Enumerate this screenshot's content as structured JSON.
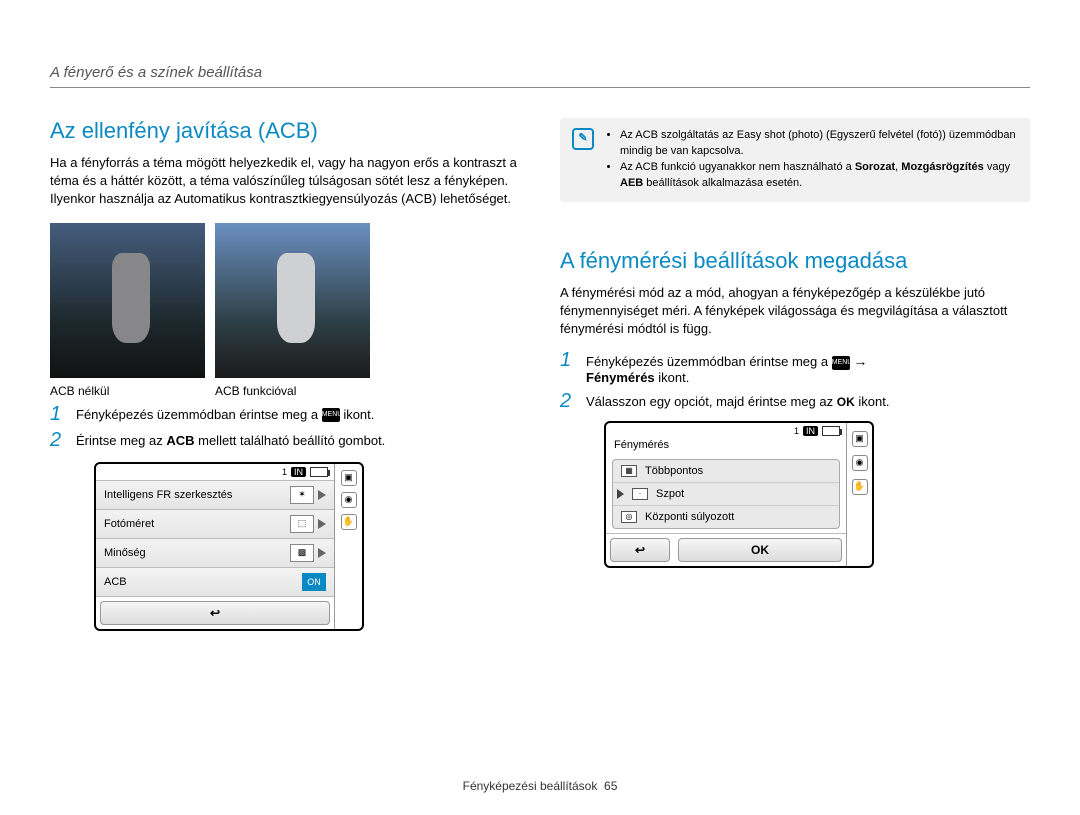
{
  "header": {
    "breadcrumb": "A fényerő és a színek beállítása"
  },
  "left": {
    "title": "Az ellenfény javítása (ACB)",
    "intro": "Ha a fényforrás a téma mögött helyezkedik el, vagy ha nagyon erős a kontraszt a téma és a háttér között, a téma valószínűleg túlságosan sötét lesz a fényképen. Ilyenkor használja az Automatikus kontrasztkiegyensúlyozás (ACB) lehetőséget.",
    "cap_without": "ACB nélkül",
    "cap_with": "ACB funkcióval",
    "step1_pre": "Fényképezés üzemmódban érintse meg a ",
    "step1_post": " ikont.",
    "step2_pre": "Érintse meg az ",
    "step2_bold": "ACB",
    "step2_post": " mellett található beállító gombot.",
    "screen": {
      "top_count": "1",
      "top_in": "IN",
      "rows": {
        "r1": "Intelligens FR szerkesztés",
        "r2": "Fotóméret",
        "r3": "Minőség",
        "r4": "ACB",
        "on": "ON"
      },
      "back": "↩"
    }
  },
  "right": {
    "note": {
      "b1_pre": "Az ACB szolgáltatás az Easy shot (photo) (Egyszerű felvétel (fotó)) üzemmódban mindig be van kapcsolva.",
      "b2_pre": "Az ACB funkció ugyanakkor nem használható a ",
      "b2_b1": "Sorozat",
      "b2_mid": ", ",
      "b2_b2": "Mozgásrögzítés",
      "b2_mid2": " vagy ",
      "b2_b3": "AEB",
      "b2_post": " beállítások alkalmazása esetén."
    },
    "title": "A fénymérési beállítások megadása",
    "intro": "A fénymérési mód az a mód, ahogyan a fényképezőgép a készülékbe jutó fénymennyiséget méri. A fényképek világossága és megvilágítása a választott fénymérési módtól is függ.",
    "step1_pre": "Fényképezés üzemmódban érintse meg a ",
    "step1_arrow": "→",
    "step1_bold": "Fénymérés",
    "step1_post": " ikont.",
    "step2_pre": "Válasszon egy opciót, majd érintse meg az ",
    "step2_ok": "OK",
    "step2_post": " ikont.",
    "screen": {
      "title": "Fénymérés",
      "top_count": "1",
      "top_in": "IN",
      "opts": {
        "o1": "Többpontos",
        "o2": "Szpot",
        "o3": "Központi súlyozott"
      },
      "back": "↩",
      "ok": "OK"
    }
  },
  "footer": {
    "label": "Fényképezési beállítások",
    "page": "65"
  },
  "icons": {
    "menu": "MENU"
  }
}
